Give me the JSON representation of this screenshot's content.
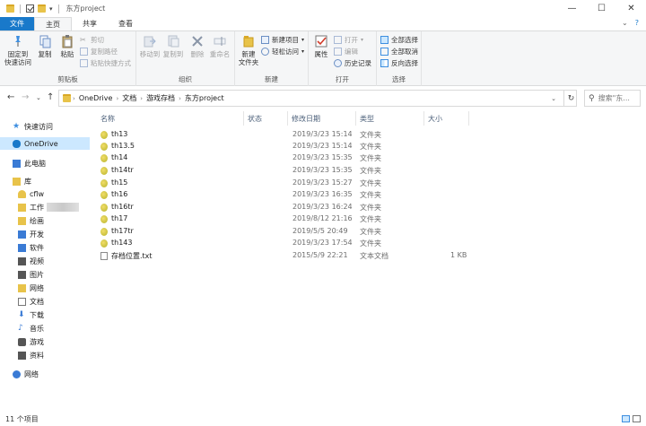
{
  "window": {
    "title": "东方project",
    "min_glyph": "—",
    "max_glyph": "☐",
    "close_glyph": "✕"
  },
  "ribbon_tabs": [
    {
      "label": "文件"
    },
    {
      "label": "主页"
    },
    {
      "label": "共享"
    },
    {
      "label": "查看"
    }
  ],
  "ribbon": {
    "clipboard": {
      "label": "剪贴板",
      "pin": "固定到\n快速访问",
      "copy": "复制",
      "paste": "粘贴",
      "cut": "剪切",
      "copy_path": "复制路径",
      "paste_shortcut": "粘贴快捷方式"
    },
    "organize": {
      "label": "组织",
      "move_to": "移动到",
      "copy_to": "复制到",
      "delete": "删除",
      "rename": "重命名"
    },
    "new": {
      "label": "新建",
      "new_folder": "新建\n文件夹",
      "new_item": "新建项目",
      "easy_access": "轻松访问"
    },
    "open": {
      "label": "打开",
      "properties": "属性",
      "open": "打开",
      "edit": "编辑",
      "history": "历史记录"
    },
    "select": {
      "label": "选择",
      "select_all": "全部选择",
      "select_none": "全部取消",
      "invert": "反向选择"
    }
  },
  "address": {
    "crumbs": [
      "OneDrive",
      "文档",
      "游戏存档",
      "东方project"
    ],
    "search_placeholder": "搜索\"东..."
  },
  "sidebar": {
    "items": [
      {
        "label": "快速访问",
        "icon": "star-icon",
        "color": "#3d8ee0"
      },
      {
        "label": "OneDrive",
        "icon": "cloud-icon",
        "color": "#1979ca"
      },
      {
        "label": "此电脑",
        "icon": "computer-icon",
        "color": "#3a7bd5"
      },
      {
        "label": "库",
        "icon": "library-icon",
        "color": "#e8c34a"
      },
      {
        "label": "cflw",
        "icon": "user-folder-icon",
        "color": "#e8c34a"
      },
      {
        "label": "工作",
        "icon": "folder-icon",
        "color": "#e8c34a"
      },
      {
        "label": "绘画",
        "icon": "folder-icon",
        "color": "#e8c34a"
      },
      {
        "label": "开发",
        "icon": "code-icon",
        "color": "#3a7bd5"
      },
      {
        "label": "软件",
        "icon": "software-icon",
        "color": "#3a7bd5"
      },
      {
        "label": "视频",
        "icon": "video-icon",
        "color": "#555555"
      },
      {
        "label": "图片",
        "icon": "pictures-icon",
        "color": "#555555"
      },
      {
        "label": "网络",
        "icon": "folder-icon",
        "color": "#e8c34a"
      },
      {
        "label": "文档",
        "icon": "documents-icon",
        "color": "#777777"
      },
      {
        "label": "下载",
        "icon": "download-icon",
        "color": "#3a7bd5"
      },
      {
        "label": "音乐",
        "icon": "music-icon",
        "color": "#3a7bd5"
      },
      {
        "label": "游戏",
        "icon": "game-icon",
        "color": "#555555"
      },
      {
        "label": "资料",
        "icon": "data-icon",
        "color": "#555555"
      },
      {
        "label": "网络",
        "icon": "network-icon",
        "color": "#3a7bd5"
      }
    ]
  },
  "columns": {
    "name": "名称",
    "status": "状态",
    "modified": "修改日期",
    "type": "类型",
    "size": "大小"
  },
  "files": [
    {
      "name": "th13",
      "modified": "2019/3/23 15:14",
      "type": "文件夹",
      "size": "",
      "kind": "folder"
    },
    {
      "name": "th13.5",
      "modified": "2019/3/23 15:14",
      "type": "文件夹",
      "size": "",
      "kind": "folder"
    },
    {
      "name": "th14",
      "modified": "2019/3/23 15:35",
      "type": "文件夹",
      "size": "",
      "kind": "folder"
    },
    {
      "name": "th14tr",
      "modified": "2019/3/23 15:35",
      "type": "文件夹",
      "size": "",
      "kind": "folder"
    },
    {
      "name": "th15",
      "modified": "2019/3/23 15:27",
      "type": "文件夹",
      "size": "",
      "kind": "folder"
    },
    {
      "name": "th16",
      "modified": "2019/3/23 16:35",
      "type": "文件夹",
      "size": "",
      "kind": "folder"
    },
    {
      "name": "th16tr",
      "modified": "2019/3/23 16:24",
      "type": "文件夹",
      "size": "",
      "kind": "folder"
    },
    {
      "name": "th17",
      "modified": "2019/8/12 21:16",
      "type": "文件夹",
      "size": "",
      "kind": "folder"
    },
    {
      "name": "th17tr",
      "modified": "2019/5/5 20:49",
      "type": "文件夹",
      "size": "",
      "kind": "folder"
    },
    {
      "name": "th143",
      "modified": "2019/3/23 17:54",
      "type": "文件夹",
      "size": "",
      "kind": "folder"
    },
    {
      "name": "存档位置.txt",
      "modified": "2015/5/9 22:21",
      "type": "文本文档",
      "size": "1 KB",
      "kind": "txt"
    }
  ],
  "status": {
    "count": "11 个项目"
  },
  "colors": {
    "accent": "#1979ca",
    "selection": "#cce8ff"
  }
}
